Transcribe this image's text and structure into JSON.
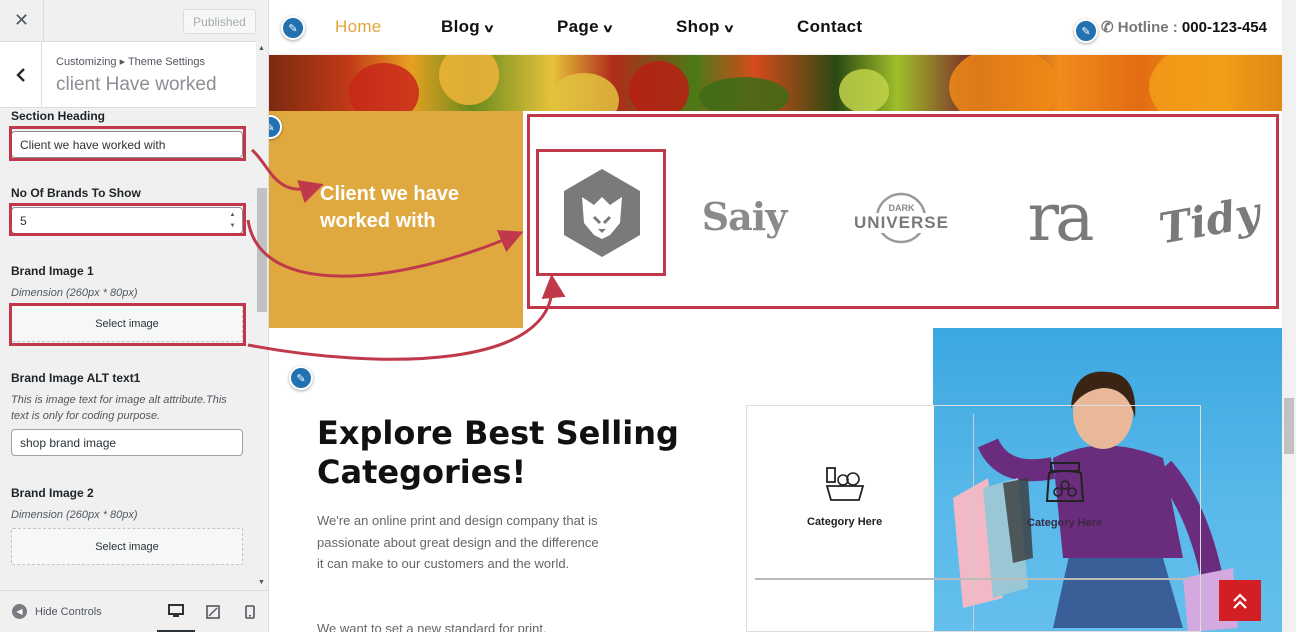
{
  "sidebar": {
    "close_icon": "close-icon",
    "published_label": "Published",
    "breadcrumb": "Customizing ▸ Theme Settings",
    "section_title": "client Have worked",
    "fields": {
      "section_heading_label": "Section Heading",
      "section_heading_value": "Client we have worked with",
      "brands_to_show_label": "No Of Brands To Show",
      "brands_to_show_value": "5",
      "brand1_label": "Brand Image 1",
      "brand1_desc": "Dimension (260px * 80px)",
      "brand1_button": "Select image",
      "brand1_alt_label": "Brand Image ALT text1",
      "brand1_alt_desc": "This is image text for image alt attribute.This text is only for coding purpose.",
      "brand1_alt_value": "shop brand image",
      "brand2_label": "Brand Image 2",
      "brand2_desc": "Dimension (260px * 80px)",
      "brand2_button": "Select image"
    },
    "footer": {
      "hide_controls": "Hide Controls",
      "devices": [
        "desktop-icon",
        "tablet-icon",
        "mobile-icon"
      ],
      "active_device": "desktop"
    }
  },
  "preview": {
    "nav": {
      "items": [
        {
          "label": "Home",
          "active": true
        },
        {
          "label": "Blog",
          "dropdown": true
        },
        {
          "label": "Page",
          "dropdown": true
        },
        {
          "label": "Shop",
          "dropdown": true
        },
        {
          "label": "Contact"
        }
      ],
      "hotline_label": "Hotline :",
      "hotline_number": "000-123-454"
    },
    "brands": {
      "heading": "Client we have worked with",
      "logos": [
        {
          "name": "lion-logo",
          "text": ""
        },
        {
          "name": "saiy-logo",
          "text": "Saiy"
        },
        {
          "name": "dark-universe-logo",
          "text_top": "DARK",
          "text": "UNIVERSE"
        },
        {
          "name": "ra-logo",
          "text": "ra"
        },
        {
          "name": "tidy-logo",
          "text": "Tidy"
        }
      ]
    },
    "explore": {
      "heading": "Explore Best Selling Categories!",
      "paragraph1": "We're an online print and design company that is passionate about great design and the difference it can make to our customers and the world.",
      "paragraph2": "We want to set a new standard for print,"
    },
    "categories": [
      {
        "label": "Category Here",
        "icon": "grocery-basket-icon"
      },
      {
        "label": "Category Here",
        "icon": "honey-jar-icon"
      }
    ]
  },
  "colors": {
    "accent": "#e0a93f",
    "nav_active": "#e0a43c",
    "highlight": "#c0394b",
    "edit_pencil": "#2271b1",
    "scroll_top": "#d21f26"
  }
}
